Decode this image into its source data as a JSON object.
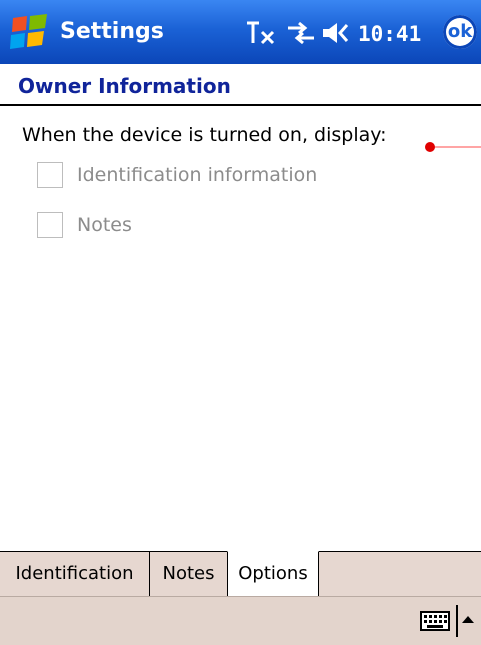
{
  "titlebar": {
    "title": "Settings",
    "time": "10:41",
    "ok_label": "ok"
  },
  "page": {
    "title": "Owner Information",
    "prompt": "When the device is turned on, display:",
    "checkboxes": [
      {
        "label": "Identification information",
        "checked": false
      },
      {
        "label": "Notes",
        "checked": false
      }
    ]
  },
  "tabs": [
    {
      "label": "Identification",
      "active": false
    },
    {
      "label": "Notes",
      "active": false
    },
    {
      "label": "Options",
      "active": true
    }
  ],
  "menubar": {
    "input_icon": "keyboard-icon",
    "input_menu_icon": "arrow-up-icon"
  },
  "colors": {
    "titlebar": "#1b62d6",
    "page_title": "#10249a",
    "tab_background": "#e6d7d0"
  }
}
